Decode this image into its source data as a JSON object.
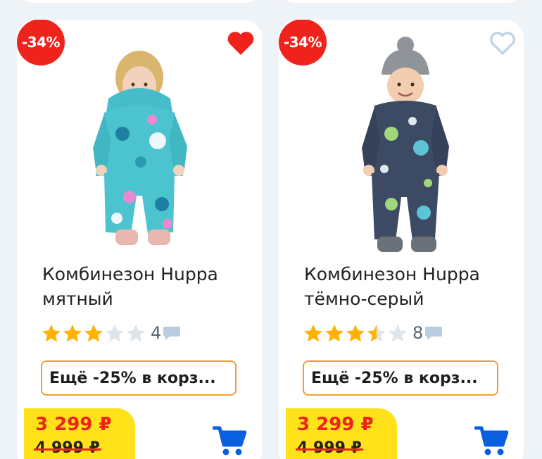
{
  "colors": {
    "discount_badge": "#f0231c",
    "favorite_active": "#f0231c",
    "favorite_inactive": "#c3d4e4",
    "star_filled": "#ffb300",
    "star_empty": "#dde4ea",
    "promo_border": "#f29c3a",
    "price_box": "#ffe21a",
    "price_new": "#f0231c",
    "cart": "#0a5fe0"
  },
  "products": [
    {
      "discount": "-34%",
      "favorite": true,
      "favorite_icon": "heart-filled-icon",
      "title": "Комбинезон Hupра мятный",
      "title_line1": "Комбинезон Hupра",
      "title_line2": "мятный",
      "rating": 3,
      "reviews": "4",
      "promo": "Ещё -25% в корз...",
      "price": "3 299 ₽",
      "old_price": "4 999 ₽",
      "image_desc": "mint-snowsuit-photo"
    },
    {
      "discount": "-34%",
      "favorite": false,
      "favorite_icon": "heart-outline-icon",
      "title": "Комбинезон Hupра тёмно-серый",
      "title_line1": "Комбинезон Hupра",
      "title_line2": "тёмно-серый",
      "rating": 3.5,
      "reviews": "8",
      "promo": "Ещё -25% в корз...",
      "price": "3 299 ₽",
      "old_price": "4 999 ₽",
      "image_desc": "dark-gray-snowsuit-photo"
    }
  ]
}
